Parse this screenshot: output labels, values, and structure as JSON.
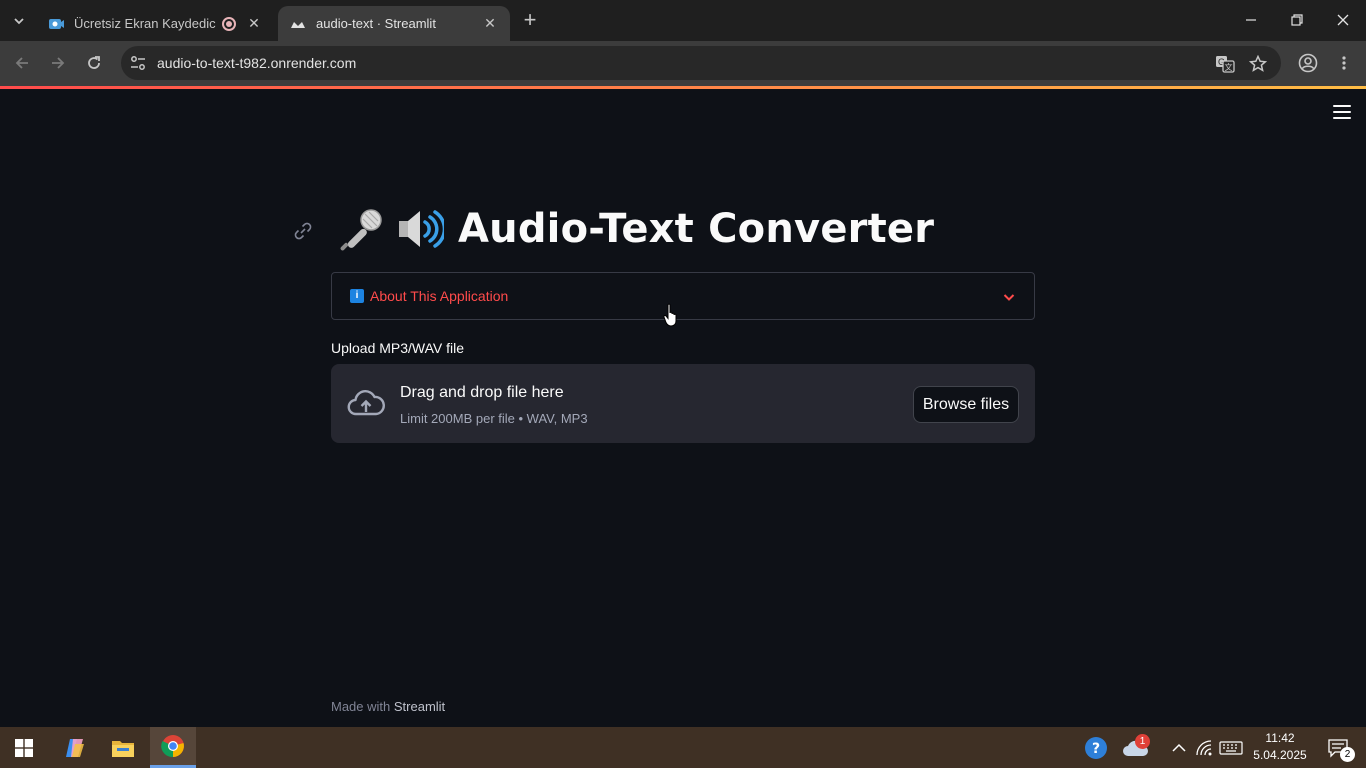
{
  "browser": {
    "tabs": [
      {
        "title": "Ücretsiz Ekran Kaydedici – V",
        "active": false
      },
      {
        "title": "audio-text · Streamlit",
        "active": true
      }
    ],
    "url": "audio-to-text-t982.onrender.com"
  },
  "app": {
    "title": "Audio-Text Converter",
    "expander_label": "About This Application",
    "upload": {
      "label": "Upload MP3/WAV file",
      "drop_text": "Drag and drop file here",
      "limit_text": "Limit 200MB per file • WAV, MP3",
      "browse_label": "Browse files"
    },
    "footer": {
      "prefix": "Made with ",
      "brand": "Streamlit"
    }
  },
  "taskbar": {
    "time": "11:42",
    "date": "5.04.2025",
    "weather_badge": "1",
    "notification_count": "2"
  },
  "colors": {
    "accent": "#ff4b4b",
    "background": "#0e1117",
    "secondary_background": "#262730",
    "info_blue": "#1c83e1"
  }
}
